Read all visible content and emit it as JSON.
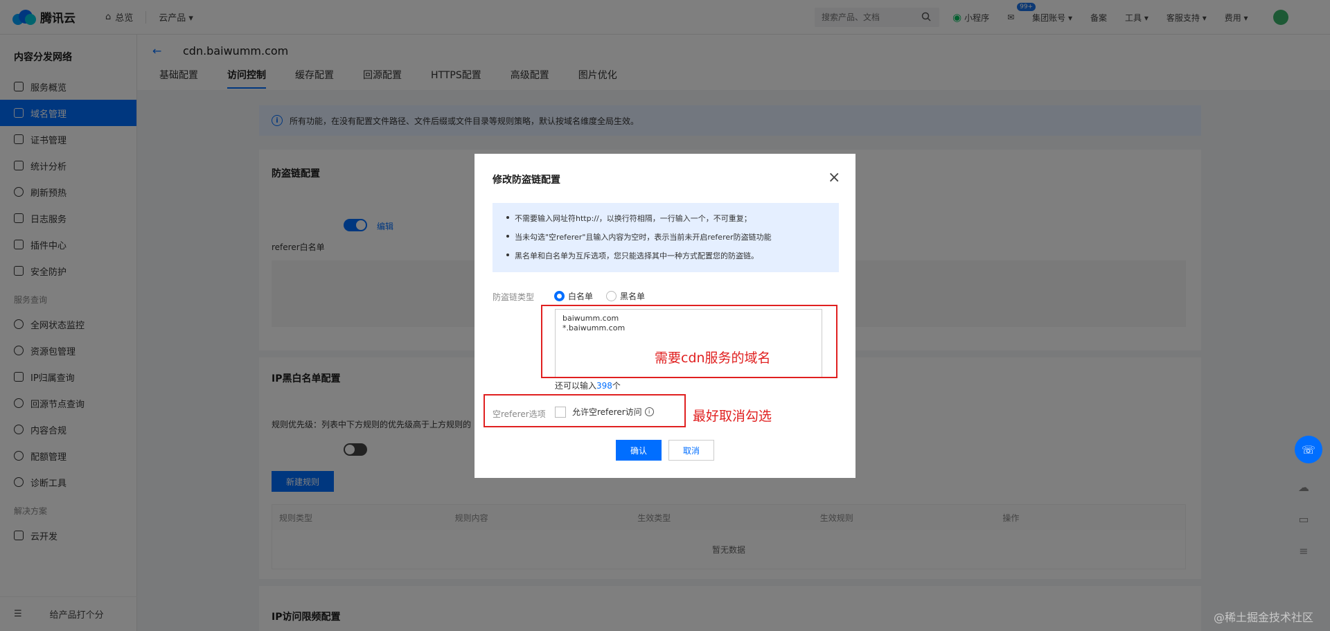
{
  "topbar": {
    "brand": "腾讯云",
    "home": "总览",
    "products": "云产品 ▾",
    "search_placeholder": "搜索产品、文档",
    "items": [
      "小程序",
      "集团账号 ▾",
      "备案",
      "工具 ▾",
      "客服支持 ▾",
      "费用 ▾"
    ],
    "badge": "99+"
  },
  "sidebar": {
    "title": "内容分发网络",
    "items": [
      "服务概览",
      "域名管理",
      "证书管理",
      "统计分析",
      "刷新预热",
      "日志服务",
      "插件中心",
      "安全防护"
    ],
    "group_service": "服务查询",
    "service_items": [
      "全网状态监控",
      "资源包管理",
      "IP归属查询",
      "回源节点查询",
      "内容合规",
      "配额管理",
      "诊断工具"
    ],
    "group_solution": "解决方案",
    "solution_items": [
      "云开发"
    ],
    "footer": "给产品打个分"
  },
  "header": {
    "domain": "cdn.baiwumm.com",
    "tabs": [
      "基础配置",
      "访问控制",
      "缓存配置",
      "回源配置",
      "HTTPS配置",
      "高级配置",
      "图片优化"
    ]
  },
  "info_bar": "所有功能，在没有配置文件路径、文件后缀或文件目录等规则策略，默认按域名维度全局生效。",
  "sections": {
    "hotlink_title": "防盗链配置",
    "hotlink_edit": "编辑",
    "referer_whitelist": "referer白名单",
    "ip_title": "IP黑白名单配置",
    "ip_priority": "规则优先级：列表中下方规则的优先级高于上方规则的",
    "new_rule": "新建规则",
    "table_headers": [
      "规则类型",
      "规则内容",
      "生效类型",
      "生效规则",
      "操作"
    ],
    "empty": "暂无数据",
    "ip_limit_title": "IP访问限频配置"
  },
  "modal": {
    "title": "修改防盗链配置",
    "tips": [
      "不需要输入网址符http://，以换行符相隔，一行输入一个，不可重复；",
      "当未勾选\"空referer\"且输入内容为空时，表示当前未开启referer防盗链功能",
      "黑名单和白名单为互斥选项，您只能选择其中一种方式配置您的防盗链。"
    ],
    "type_label": "防盗链类型",
    "whitelist": "白名单",
    "blacklist": "黑名单",
    "referer_value": "baiwumm.com\n*.baiwumm.com",
    "remain_prefix": "还可以输入",
    "remain_num": "398",
    "remain_suffix": "个",
    "empty_label": "空referer选项",
    "allow_empty": "允许空referer访问",
    "confirm": "确认",
    "cancel": "取消"
  },
  "annotations": {
    "domain_note": "需要cdn服务的域名",
    "uncheck_note": "最好取消勾选"
  },
  "watermark": "@稀土掘金技术社区",
  "colors": {
    "brand": "#006eff",
    "annotation": "#e02020"
  }
}
